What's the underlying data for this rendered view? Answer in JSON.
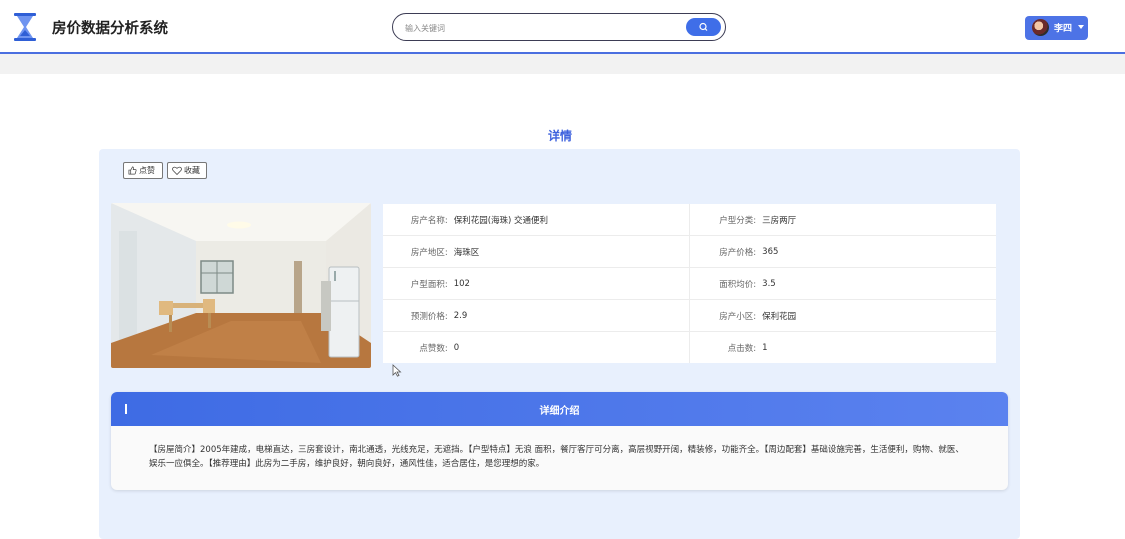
{
  "header": {
    "app_title": "房价数据分析系统",
    "logo_icon": "hourglass-icon",
    "search_placeholder": "输入关键词",
    "search_icon": "search-icon",
    "user_name": "李四",
    "accent_color": "#4b6fe0"
  },
  "detail": {
    "section_title": "详情",
    "like_label": "点赞",
    "favorite_label": "收藏",
    "photo_alt": "房屋照片",
    "fields": [
      {
        "label": "房产名称:",
        "value": "保利花园(海珠) 交通便利",
        "label2": "户型分类:",
        "value2": "三房两厅"
      },
      {
        "label": "房产地区:",
        "value": "海珠区",
        "label2": "房产价格:",
        "value2": "365"
      },
      {
        "label": "户型面积:",
        "value": "102",
        "label2": "面积均价:",
        "value2": "3.5"
      },
      {
        "label": "预测价格:",
        "value": "2.9",
        "label2": "房产小区:",
        "value2": "保利花园"
      },
      {
        "label": "点赞数:",
        "value": "0",
        "label2": "点击数:",
        "value2": "1"
      }
    ]
  },
  "intro": {
    "title": "详细介绍",
    "text": "【房屋简介】2005年建成，电梯直达，三房套设计，南北通透，光线充足，无遮挡。【户型特点】无浪 面积，餐厅客厅可分离，高层视野开阔，精装修，功能齐全。【周边配套】基础设施完善，生活便利，购物、就医、娱乐一应俱全。【推荐理由】此房为二手房，维护良好，朝向良好，通风性佳，适合居住，是您理想的家。"
  }
}
